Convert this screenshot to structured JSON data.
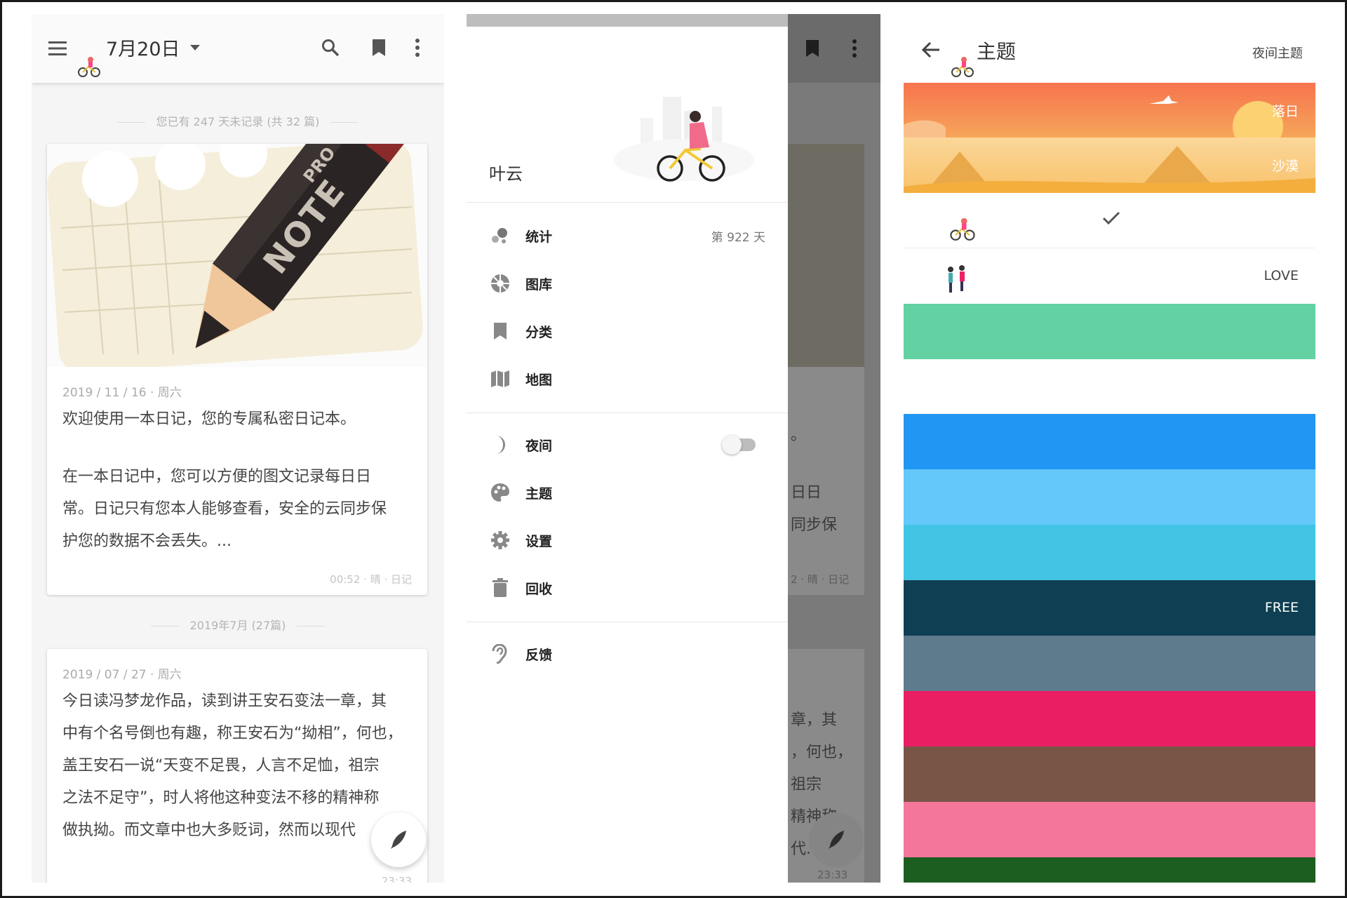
{
  "list_panel": {
    "header": {
      "date": "7月20日"
    },
    "summary": "您已有 247 天未记录 (共 32 篇)",
    "cover_badge_pro": "PRO",
    "cover_badge_note": "NOTE",
    "entries": [
      {
        "date": "2019 / 11 / 16 · 周六",
        "lines": [
          "欢迎使用一本日记，您的专属私密日记本。",
          "",
          "在一本日记中，您可以方便的图文记录每日日",
          "常。日记只有您本人能够查看，安全的云同步保",
          "护您的数据不会丢失。..."
        ],
        "footer": "00:52 · 晴 · 日记"
      },
      {
        "date": "2019 / 07 / 27 · 周六",
        "lines": [
          "今日读冯梦龙作品，读到讲王安石变法一章，其",
          "中有个名号倒也有趣，称王安石为“拗相”，何也，",
          "盖王安石一说“天变不足畏，人言不足恤，祖宗",
          "之法不足守”，时人将他这种变法不移的精神称",
          "做执拗。而文章中也大多贬词，然而以现代"
        ],
        "footer": "23:33"
      }
    ],
    "month_divider": "2019年7月 (27篇)"
  },
  "drawer_panel": {
    "username": "叶云",
    "items": [
      {
        "label": "统计",
        "icon": "stats-icon",
        "right": "第 922 天"
      },
      {
        "label": "图库",
        "icon": "aperture-icon"
      },
      {
        "label": "分类",
        "icon": "bookmark-icon"
      },
      {
        "label": "地图",
        "icon": "map-icon"
      },
      {
        "label": "夜间",
        "icon": "moon-icon",
        "toggle": false
      },
      {
        "label": "主题",
        "icon": "palette-icon"
      },
      {
        "label": "设置",
        "icon": "gear-icon"
      },
      {
        "label": "回收",
        "icon": "trash-icon"
      },
      {
        "label": "反馈",
        "icon": "ear-icon"
      }
    ],
    "behind": {
      "lines": [
        "。",
        "日日",
        "同步保",
        "2 · 晴 · 日记",
        "章，其",
        "，何也，",
        "祖宗",
        "精神称",
        "代."
      ],
      "footer2": "23:33"
    }
  },
  "theme_panel": {
    "title": "主题",
    "night_label": "夜间主题",
    "sunset_label": "落日",
    "desert_label": "沙漠",
    "love_label": "LOVE",
    "free_label": "FREE",
    "colors": {
      "mint": "#63d1a1",
      "blue": "#2196f3",
      "sky": "#64c9fa",
      "cyan": "#42c5e4",
      "navy": "#0f3f52",
      "slate": "#5d7b8c",
      "crimson": "#e91e63",
      "brown": "#795548",
      "pink": "#f5769b",
      "green": "#1b5e20"
    }
  }
}
